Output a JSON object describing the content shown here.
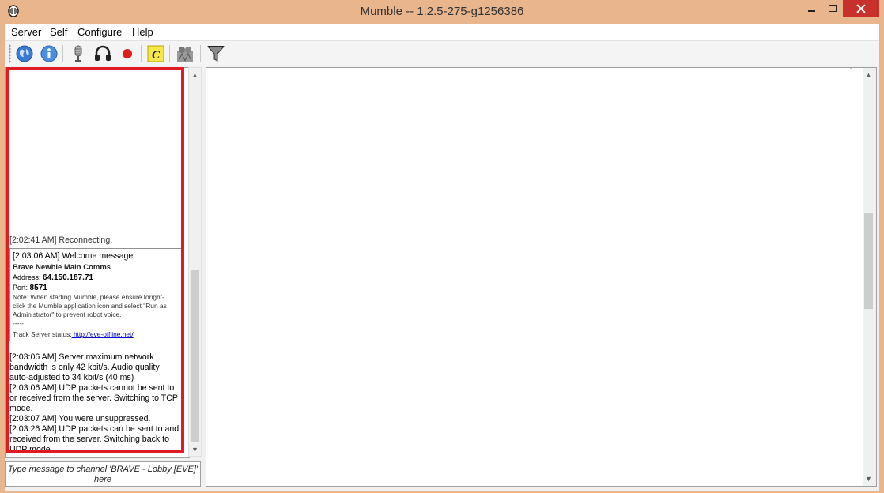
{
  "window": {
    "title": "Mumble -- 1.2.5-275-g1256386",
    "minimize_icon": "minimize-icon",
    "maximize_icon": "maximize-icon",
    "close_icon": "close-icon"
  },
  "menu": [
    "Server",
    "Self",
    "Configure",
    "Help"
  ],
  "toolbar": {
    "icons": [
      "connect-globe-icon",
      "info-icon",
      "microphone-mute-icon",
      "headphones-deafen-icon",
      "record-icon",
      "comment-icon",
      "user-location-icon",
      "filter-icon"
    ]
  },
  "log": {
    "partial_line": "[2:02:41 AM] Reconnecting.",
    "welcome": {
      "header": "[2:03:06 AM] Welcome message:",
      "server_name": "Brave Newbie Main Comms",
      "address_label": "Address:",
      "address_value": "64.150.187.71",
      "port_label": "Port:",
      "port_value": "8571",
      "note_1": "Note: When starting Mumble, please ensure toright-",
      "note_2": "click the Mumble application icon and select \"Run as",
      "note_3": "Administrator\" to prevent robot voice.",
      "divider": "-----",
      "status_label": "Track Server status:",
      "status_link": " http://eve-offline.net/"
    },
    "lines": [
      "[2:03:06 AM] Server maximum network",
      "bandwidth is only 42 kbit/s. Audio quality",
      "auto-adjusted to 34 kbit/s (40 ms)",
      "[2:03:06 AM] UDP packets cannot be sent to",
      "or received from the server. Switching to TCP",
      "mode.",
      "[2:03:07 AM] You were unsuppressed.",
      "[2:03:26 AM] UDP packets can be sent to and",
      "received from the server. Switching back to",
      "UDP mode."
    ]
  },
  "chat_input": {
    "placeholder_1": "Type message to channel 'BRAVE - Lobby [EVE]'",
    "placeholder_2": "here"
  },
  "colors": {
    "frame": "#e8b58c",
    "close": "#c7302b",
    "highlight": "#e01b24",
    "link": "#0000cc"
  }
}
